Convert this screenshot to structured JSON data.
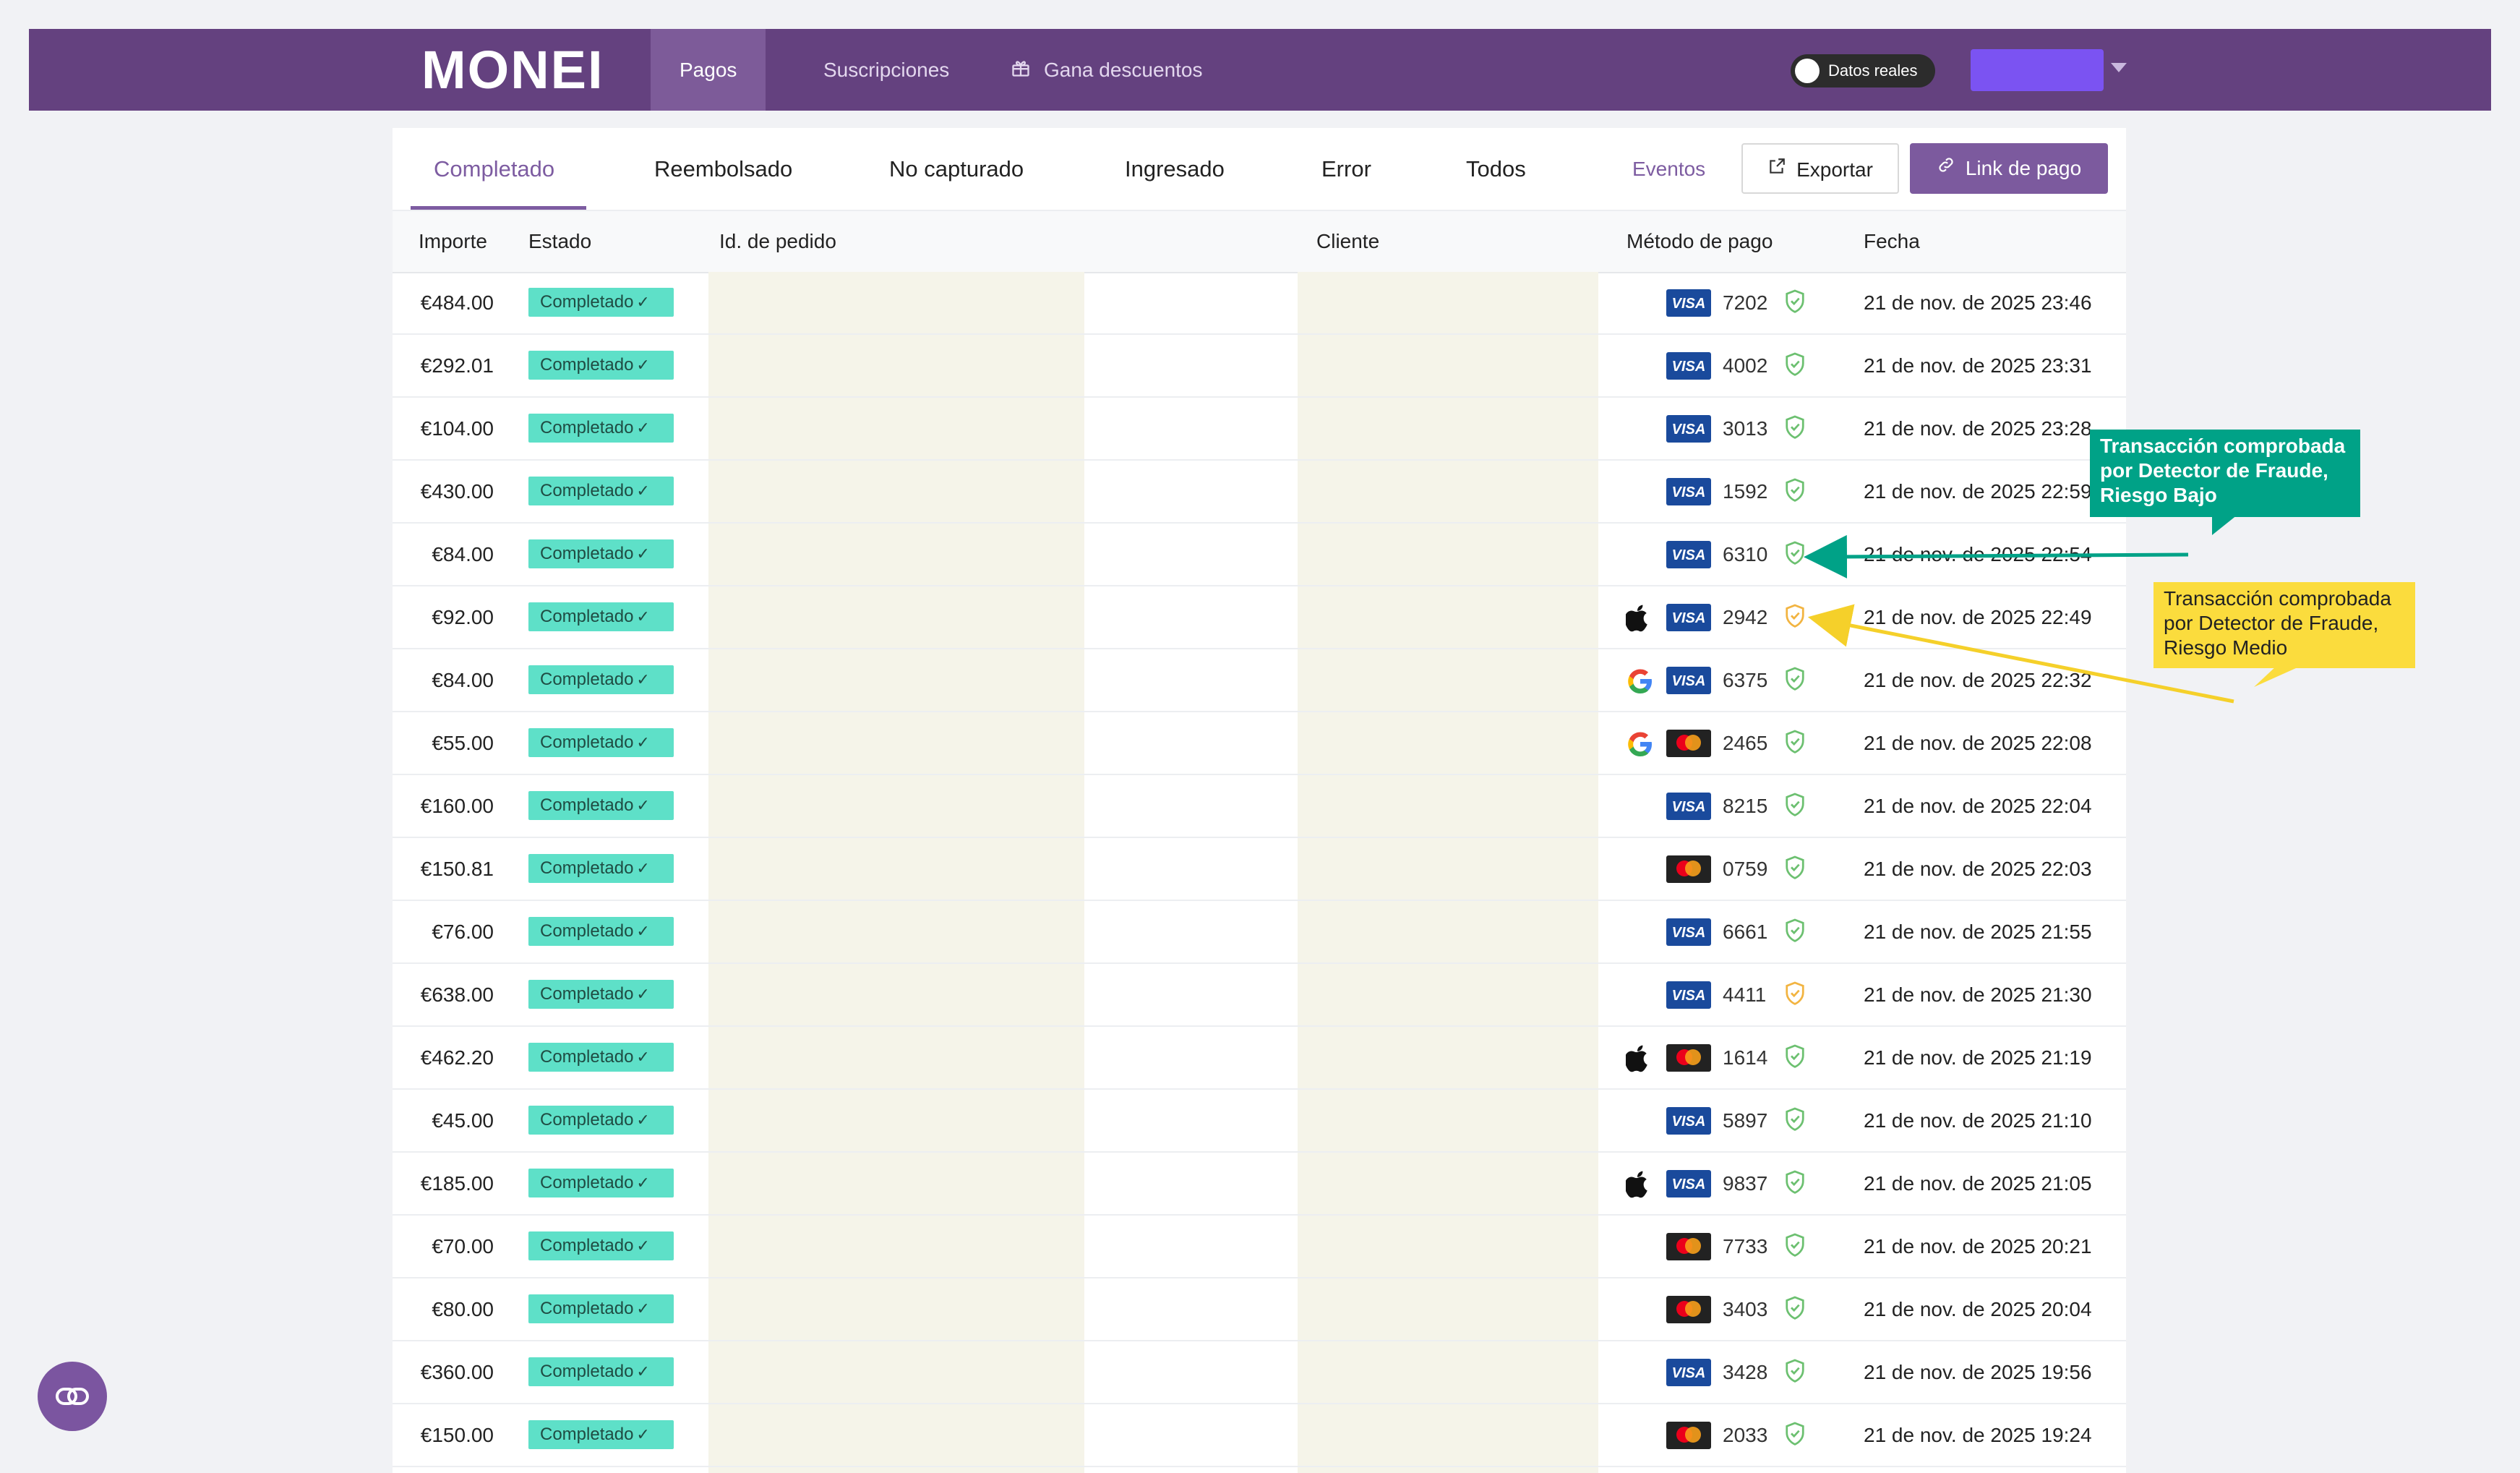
{
  "navbar": {
    "logo": "MONEI",
    "tabs": [
      {
        "label": "Pagos",
        "active": true
      },
      {
        "label": "Suscripciones",
        "active": false
      },
      {
        "label": "Gana descuentos",
        "active": false,
        "icon": "gift-icon"
      }
    ],
    "live_toggle_label": "Datos reales"
  },
  "status_tabs": [
    {
      "label": "Completado",
      "active": true
    },
    {
      "label": "Reembolsado"
    },
    {
      "label": "No capturado"
    },
    {
      "label": "Ingresado"
    },
    {
      "label": "Error"
    },
    {
      "label": "Todos"
    }
  ],
  "actions": {
    "events_label": "Eventos",
    "export_label": "Exportar",
    "payment_link_label": "Link de pago"
  },
  "table": {
    "headers": {
      "amount": "Importe",
      "status": "Estado",
      "order_id": "Id. de pedido",
      "customer": "Cliente",
      "payment_method": "Método de pago",
      "date": "Fecha"
    },
    "status_label": "Completado",
    "rows": [
      {
        "amount": "€484.00",
        "wallet": "",
        "card": "visa",
        "last4": "7202",
        "risk": "low",
        "date": "21 de nov. de 2025 23:46"
      },
      {
        "amount": "€292.01",
        "wallet": "",
        "card": "visa",
        "last4": "4002",
        "risk": "low",
        "date": "21 de nov. de 2025 23:31"
      },
      {
        "amount": "€104.00",
        "wallet": "",
        "card": "visa",
        "last4": "3013",
        "risk": "low",
        "date": "21 de nov. de 2025 23:28"
      },
      {
        "amount": "€430.00",
        "wallet": "",
        "card": "visa",
        "last4": "1592",
        "risk": "low",
        "date": "21 de nov. de 2025 22:59"
      },
      {
        "amount": "€84.00",
        "wallet": "",
        "card": "visa",
        "last4": "6310",
        "risk": "low",
        "date": "21 de nov. de 2025 22:54"
      },
      {
        "amount": "€92.00",
        "wallet": "apple",
        "card": "visa",
        "last4": "2942",
        "risk": "medium",
        "date": "21 de nov. de 2025 22:49"
      },
      {
        "amount": "€84.00",
        "wallet": "google",
        "card": "visa",
        "last4": "6375",
        "risk": "low",
        "date": "21 de nov. de 2025 22:32"
      },
      {
        "amount": "€55.00",
        "wallet": "google",
        "card": "mastercard",
        "last4": "2465",
        "risk": "low",
        "date": "21 de nov. de 2025 22:08"
      },
      {
        "amount": "€160.00",
        "wallet": "",
        "card": "visa",
        "last4": "8215",
        "risk": "low",
        "date": "21 de nov. de 2025 22:04"
      },
      {
        "amount": "€150.81",
        "wallet": "",
        "card": "mastercard",
        "last4": "0759",
        "risk": "low",
        "date": "21 de nov. de 2025 22:03"
      },
      {
        "amount": "€76.00",
        "wallet": "",
        "card": "visa",
        "last4": "6661",
        "risk": "low",
        "date": "21 de nov. de 2025 21:55"
      },
      {
        "amount": "€638.00",
        "wallet": "",
        "card": "visa",
        "last4": "4411",
        "risk": "medium",
        "date": "21 de nov. de 2025 21:30"
      },
      {
        "amount": "€462.20",
        "wallet": "apple",
        "card": "mastercard",
        "last4": "1614",
        "risk": "low",
        "date": "21 de nov. de 2025 21:19"
      },
      {
        "amount": "€45.00",
        "wallet": "",
        "card": "visa",
        "last4": "5897",
        "risk": "low",
        "date": "21 de nov. de 2025 21:10"
      },
      {
        "amount": "€185.00",
        "wallet": "apple",
        "card": "visa",
        "last4": "9837",
        "risk": "low",
        "date": "21 de nov. de 2025 21:05"
      },
      {
        "amount": "€70.00",
        "wallet": "",
        "card": "mastercard",
        "last4": "7733",
        "risk": "low",
        "date": "21 de nov. de 2025 20:21"
      },
      {
        "amount": "€80.00",
        "wallet": "",
        "card": "mastercard",
        "last4": "3403",
        "risk": "low",
        "date": "21 de nov. de 2025 20:04"
      },
      {
        "amount": "€360.00",
        "wallet": "",
        "card": "visa",
        "last4": "3428",
        "risk": "low",
        "date": "21 de nov. de 2025 19:56"
      },
      {
        "amount": "€150.00",
        "wallet": "",
        "card": "mastercard",
        "last4": "2033",
        "risk": "low",
        "date": "21 de nov. de 2025 19:24"
      }
    ]
  },
  "annotations": {
    "low_risk": "Transacción comprobada por Detector de Fraude, Riesgo Bajo",
    "medium_risk": "Transacción comprobada por Detector de Fraude, Riesgo Medio"
  },
  "colors": {
    "brand": "#64417f",
    "accent": "#7d5ca1",
    "status_badge": "#5ee0c8",
    "risk_low": "#6cc070",
    "risk_medium": "#f2b441",
    "annotation_green": "#00a287",
    "annotation_yellow": "#fbdc3d"
  }
}
